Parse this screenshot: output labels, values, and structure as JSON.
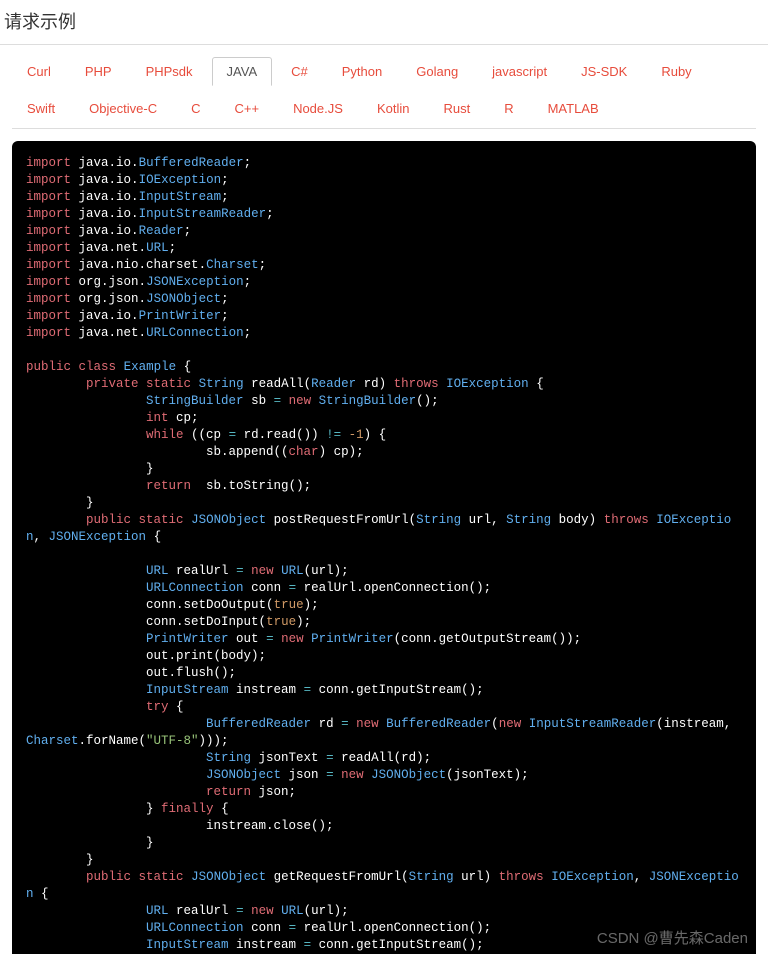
{
  "title": "请求示例",
  "tabs": [
    "Curl",
    "PHP",
    "PHPsdk",
    "JAVA",
    "C#",
    "Python",
    "Golang",
    "javascript",
    "JS-SDK",
    "Ruby",
    "Swift",
    "Objective-C",
    "C",
    "C++",
    "Node.JS",
    "Kotlin",
    "Rust",
    "R",
    "MATLAB"
  ],
  "activeTab": "JAVA",
  "watermark": "CSDN @曹先森Caden",
  "code": {
    "imports": [
      {
        "pkg": "java.io",
        "cls": "BufferedReader"
      },
      {
        "pkg": "java.io",
        "cls": "IOException"
      },
      {
        "pkg": "java.io",
        "cls": "InputStream"
      },
      {
        "pkg": "java.io",
        "cls": "InputStreamReader"
      },
      {
        "pkg": "java.io",
        "cls": "Reader"
      },
      {
        "pkg": "java.net",
        "cls": "URL"
      },
      {
        "pkg": "java.nio.charset",
        "cls": "Charset"
      },
      {
        "pkg": "org.json",
        "cls": "JSONException"
      },
      {
        "pkg": "org.json",
        "cls": "JSONObject"
      },
      {
        "pkg": "java.io",
        "cls": "PrintWriter"
      },
      {
        "pkg": "java.net",
        "cls": "URLConnection"
      }
    ],
    "className": "Example",
    "charsetName": "UTF-8",
    "neg1": "-1"
  }
}
